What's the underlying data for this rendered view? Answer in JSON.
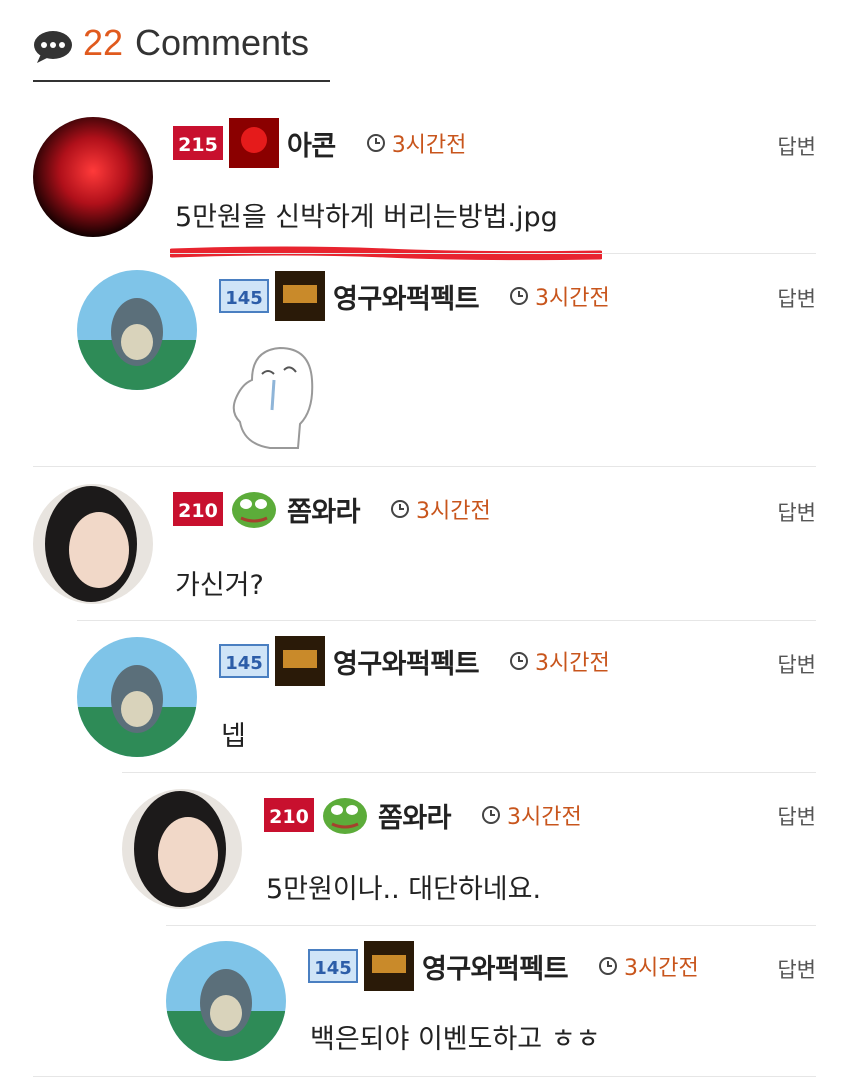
{
  "header": {
    "count": "22",
    "label": "Comments"
  },
  "reply_label": "답변",
  "comments": [
    {
      "nick": "아콘",
      "time": "3시간전",
      "text": "5만원을 신박하게 버리는방법.jpg",
      "level": "215"
    },
    {
      "nick": "영구와퍽펙트",
      "time": "3시간전",
      "text": "",
      "level": "145"
    },
    {
      "nick": "쫌와라",
      "time": "3시간전",
      "text": "가신거?",
      "level": "210"
    },
    {
      "nick": "영구와퍽펙트",
      "time": "3시간전",
      "text": "넵",
      "level": "145"
    },
    {
      "nick": "쫌와라",
      "time": "3시간전",
      "text": "5만원이나.. 대단하네요.",
      "level": "210"
    },
    {
      "nick": "영구와퍽펙트",
      "time": "3시간전",
      "text": "백은되야 이벤도하고 ㅎㅎ",
      "level": "145"
    }
  ],
  "colors": {
    "accent": "#e05a1e",
    "underline": "#e8242f"
  }
}
